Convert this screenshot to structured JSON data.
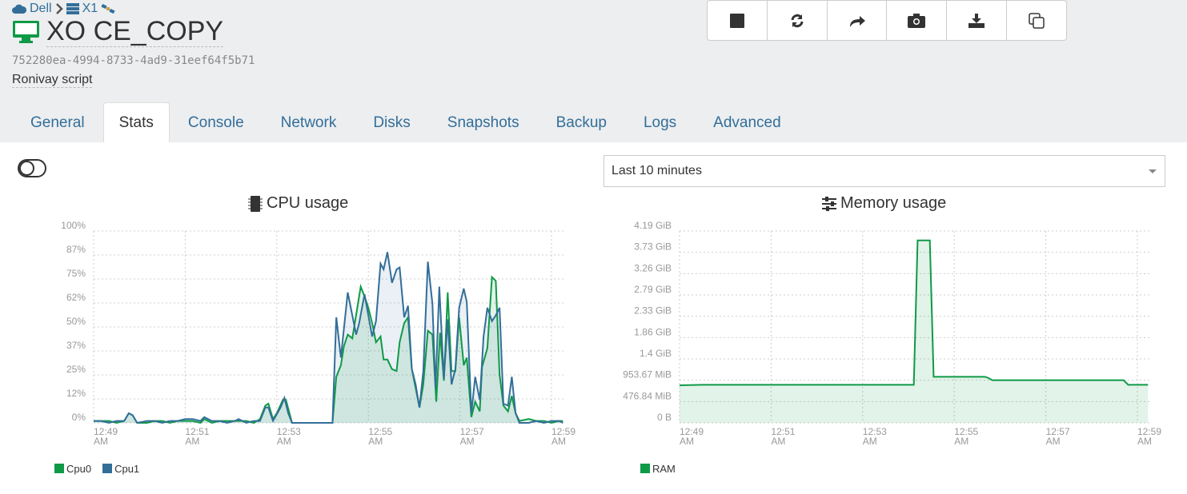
{
  "breadcrumb": {
    "pool": "Dell",
    "host": "X1"
  },
  "vm": {
    "name": "XO CE_COPY",
    "uuid": "752280ea-4994-8733-4ad9-31eef64f5b71",
    "description": "Ronivay script"
  },
  "toolbar": [
    {
      "icon": "stop-icon"
    },
    {
      "icon": "restart-icon"
    },
    {
      "icon": "migrate-icon"
    },
    {
      "icon": "camera-icon"
    },
    {
      "icon": "export-icon"
    },
    {
      "icon": "copy-icon"
    }
  ],
  "tabs": [
    "General",
    "Stats",
    "Console",
    "Network",
    "Disks",
    "Snapshots",
    "Backup",
    "Logs",
    "Advanced"
  ],
  "active_tab": "Stats",
  "granularity": "Last 10 minutes",
  "colors": {
    "green": "#0f9a47",
    "blue": "#336e99",
    "link": "#336e99"
  },
  "chart_data": [
    {
      "type": "area",
      "title": "CPU usage",
      "ylim": [
        0,
        100
      ],
      "yticks": [
        "0%",
        "12%",
        "25%",
        "37%",
        "50%",
        "62%",
        "75%",
        "87%",
        "100%"
      ],
      "xticks": [
        "12:49",
        "12:51",
        "12:53",
        "12:55",
        "12:57",
        "12:59"
      ],
      "xtick_suffix": "AM",
      "grid": true,
      "legend": "bottom-left",
      "series": [
        {
          "name": "Cpu0",
          "color": "#0f9a47",
          "points": [
            [
              "12:49:00",
              1
            ],
            [
              "12:49:10",
              1
            ],
            [
              "12:49:20",
              1
            ],
            [
              "12:49:30",
              0
            ],
            [
              "12:49:40",
              1
            ],
            [
              "12:49:46",
              5
            ],
            [
              "12:49:51",
              4
            ],
            [
              "12:49:57",
              0
            ],
            [
              "12:50:10",
              0
            ],
            [
              "12:50:20",
              1
            ],
            [
              "12:50:30",
              1
            ],
            [
              "12:50:40",
              0
            ],
            [
              "12:50:50",
              1
            ],
            [
              "12:51:00",
              1
            ],
            [
              "12:51:10",
              1
            ],
            [
              "12:51:20",
              0
            ],
            [
              "12:51:25",
              2
            ],
            [
              "12:51:35",
              0
            ],
            [
              "12:51:45",
              1
            ],
            [
              "12:51:55",
              1
            ],
            [
              "12:52:05",
              1
            ],
            [
              "12:52:10",
              1
            ],
            [
              "12:52:20",
              1
            ],
            [
              "12:52:30",
              0
            ],
            [
              "12:52:38",
              2
            ],
            [
              "12:52:45",
              9
            ],
            [
              "12:52:49",
              10
            ],
            [
              "12:52:55",
              2
            ],
            [
              "12:53:00",
              5
            ],
            [
              "12:53:08",
              12
            ],
            [
              "12:53:12",
              12
            ],
            [
              "12:53:20",
              0
            ],
            [
              "12:54:13",
              0
            ],
            [
              "12:54:18",
              24
            ],
            [
              "12:54:24",
              30
            ],
            [
              "12:54:28",
              40
            ],
            [
              "12:54:33",
              46
            ],
            [
              "12:54:39",
              44
            ],
            [
              "12:54:50",
              71
            ],
            [
              "12:54:55",
              66
            ],
            [
              "12:55:00",
              60
            ],
            [
              "12:55:05",
              52
            ],
            [
              "12:55:10",
              42
            ],
            [
              "12:55:16",
              45
            ],
            [
              "12:55:20",
              33
            ],
            [
              "12:55:25",
              33
            ],
            [
              "12:55:31",
              28
            ],
            [
              "12:55:37",
              27
            ],
            [
              "12:55:41",
              42
            ],
            [
              "12:55:47",
              52
            ],
            [
              "12:55:52",
              55
            ],
            [
              "12:55:57",
              28
            ],
            [
              "12:56:02",
              18
            ],
            [
              "12:56:07",
              8
            ],
            [
              "12:56:12",
              20
            ],
            [
              "12:56:18",
              48
            ],
            [
              "12:56:24",
              46
            ],
            [
              "12:56:29",
              11
            ],
            [
              "12:56:34",
              47
            ],
            [
              "12:56:39",
              22
            ],
            [
              "12:56:44",
              68
            ],
            [
              "12:56:49",
              27
            ],
            [
              "12:56:54",
              27
            ],
            [
              "12:56:59",
              55
            ],
            [
              "12:57:05",
              30
            ],
            [
              "12:57:09",
              34
            ],
            [
              "12:57:15",
              3
            ],
            [
              "12:57:20",
              11
            ],
            [
              "12:57:26",
              6
            ],
            [
              "12:57:29",
              29
            ],
            [
              "12:57:36",
              39
            ],
            [
              "12:57:42",
              76
            ],
            [
              "12:57:47",
              74
            ],
            [
              "12:57:52",
              25
            ],
            [
              "12:57:57",
              9
            ],
            [
              "12:58:03",
              6
            ],
            [
              "12:58:08",
              14
            ],
            [
              "12:58:13",
              5
            ],
            [
              "12:58:18",
              1
            ],
            [
              "12:58:30",
              2
            ],
            [
              "12:58:40",
              1
            ],
            [
              "12:58:50",
              1
            ],
            [
              "12:59:00",
              0
            ],
            [
              "12:59:10",
              1
            ],
            [
              "12:59:15",
              1
            ]
          ]
        },
        {
          "name": "Cpu1",
          "color": "#336e99",
          "points": [
            [
              "12:49:00",
              1
            ],
            [
              "12:49:10",
              1
            ],
            [
              "12:49:20",
              0
            ],
            [
              "12:49:30",
              1
            ],
            [
              "12:49:40",
              1
            ],
            [
              "12:49:46",
              5
            ],
            [
              "12:49:51",
              4
            ],
            [
              "12:49:57",
              0
            ],
            [
              "12:50:10",
              1
            ],
            [
              "12:50:20",
              1
            ],
            [
              "12:50:30",
              0
            ],
            [
              "12:50:40",
              1
            ],
            [
              "12:50:50",
              1
            ],
            [
              "12:51:00",
              2
            ],
            [
              "12:51:10",
              2
            ],
            [
              "12:51:20",
              1
            ],
            [
              "12:51:25",
              3
            ],
            [
              "12:51:35",
              1
            ],
            [
              "12:51:45",
              1
            ],
            [
              "12:51:55",
              0
            ],
            [
              "12:52:05",
              1
            ],
            [
              "12:52:10",
              2
            ],
            [
              "12:52:20",
              0
            ],
            [
              "12:52:30",
              1
            ],
            [
              "12:52:38",
              1
            ],
            [
              "12:52:45",
              8
            ],
            [
              "12:52:49",
              8
            ],
            [
              "12:52:55",
              1
            ],
            [
              "12:53:05",
              8
            ],
            [
              "12:53:10",
              13
            ],
            [
              "12:53:15",
              5
            ],
            [
              "12:53:20",
              0
            ],
            [
              "12:54:13",
              0
            ],
            [
              "12:54:18",
              55
            ],
            [
              "12:54:24",
              34
            ],
            [
              "12:54:33",
              68
            ],
            [
              "12:54:44",
              46
            ],
            [
              "12:54:48",
              52
            ],
            [
              "12:54:55",
              67
            ],
            [
              "12:55:05",
              45
            ],
            [
              "12:55:10",
              53
            ],
            [
              "12:55:16",
              83
            ],
            [
              "12:55:20",
              80
            ],
            [
              "12:55:25",
              89
            ],
            [
              "12:55:31",
              73
            ],
            [
              "12:55:37",
              80
            ],
            [
              "12:55:41",
              81
            ],
            [
              "12:55:47",
              55
            ],
            [
              "12:55:52",
              61
            ],
            [
              "12:55:57",
              28
            ],
            [
              "12:56:02",
              20
            ],
            [
              "12:56:07",
              8
            ],
            [
              "12:56:12",
              27
            ],
            [
              "12:56:18",
              84
            ],
            [
              "12:56:24",
              62
            ],
            [
              "12:56:28",
              18
            ],
            [
              "12:56:33",
              71
            ],
            [
              "12:56:39",
              23
            ],
            [
              "12:56:44",
              54
            ],
            [
              "12:56:49",
              20
            ],
            [
              "12:56:54",
              28
            ],
            [
              "12:56:59",
              60
            ],
            [
              "12:57:05",
              70
            ],
            [
              "12:57:09",
              63
            ],
            [
              "12:57:15",
              5
            ],
            [
              "12:57:20",
              24
            ],
            [
              "12:57:26",
              12
            ],
            [
              "12:57:31",
              45
            ],
            [
              "12:57:36",
              60
            ],
            [
              "12:57:42",
              53
            ],
            [
              "12:57:47",
              56
            ],
            [
              "12:57:52",
              60
            ],
            [
              "12:57:57",
              10
            ],
            [
              "12:58:03",
              9
            ],
            [
              "12:58:08",
              24
            ],
            [
              "12:58:13",
              5
            ],
            [
              "12:58:18",
              0
            ],
            [
              "12:58:30",
              0
            ],
            [
              "12:58:40",
              1
            ],
            [
              "12:58:50",
              0
            ],
            [
              "12:59:00",
              1
            ],
            [
              "12:59:10",
              1
            ],
            [
              "12:59:15",
              0
            ]
          ]
        }
      ]
    },
    {
      "type": "area",
      "title": "Memory usage",
      "ylabel_unit": "MiB",
      "ylim": [
        0,
        4291.53
      ],
      "yticks": [
        "0 B",
        "476.84 MiB",
        "953.67 MiB",
        "1.4 GiB",
        "1.86 GiB",
        "2.33 GiB",
        "2.79 GiB",
        "3.26 GiB",
        "3.73 GiB",
        "4.19 GiB"
      ],
      "xticks": [
        "12:49",
        "12:51",
        "12:53",
        "12:55",
        "12:57",
        "12:59"
      ],
      "xtick_suffix": "AM",
      "grid": true,
      "legend": "bottom-left",
      "series": [
        {
          "name": "RAM",
          "color": "#0f9a47",
          "points": [
            [
              "12:49:00",
              840
            ],
            [
              "12:49:30",
              852
            ],
            [
              "12:54:07",
              852
            ],
            [
              "12:54:12",
              4082
            ],
            [
              "12:54:28",
              4082
            ],
            [
              "12:54:33",
              1031
            ],
            [
              "12:55:40",
              1031
            ],
            [
              "12:55:44",
              1010
            ],
            [
              "12:55:50",
              954
            ],
            [
              "12:58:42",
              954
            ],
            [
              "12:58:48",
              852
            ],
            [
              "12:59:14",
              852
            ]
          ]
        }
      ]
    }
  ]
}
